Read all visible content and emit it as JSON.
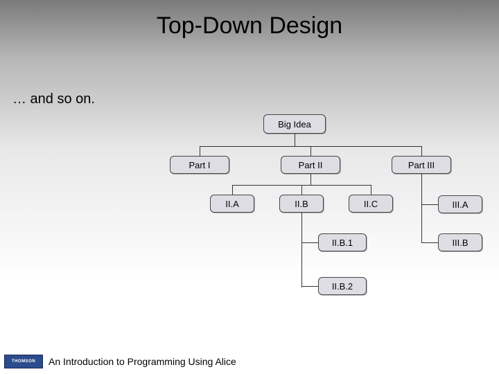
{
  "slide": {
    "title": "Top-Down Design",
    "subtext": "… and so on."
  },
  "diagram": {
    "root": "Big Idea",
    "level1": {
      "part1": "Part I",
      "part2": "Part II",
      "part3": "Part III"
    },
    "level2": {
      "iia": "II.A",
      "iib": "II.B",
      "iic": "II.C",
      "iiia": "III.A"
    },
    "level3": {
      "iib1": "II.B.1",
      "iiib": "III.B"
    },
    "level4": {
      "iib2": "II.B.2"
    }
  },
  "footer": {
    "logo_brand": "THOMSON",
    "caption": "An Introduction to Programming Using Alice"
  },
  "colors": {
    "node_fill": "#dfdde4",
    "node_border": "#444444",
    "line": "#333333",
    "logo_bg": "#2a4b8d"
  }
}
